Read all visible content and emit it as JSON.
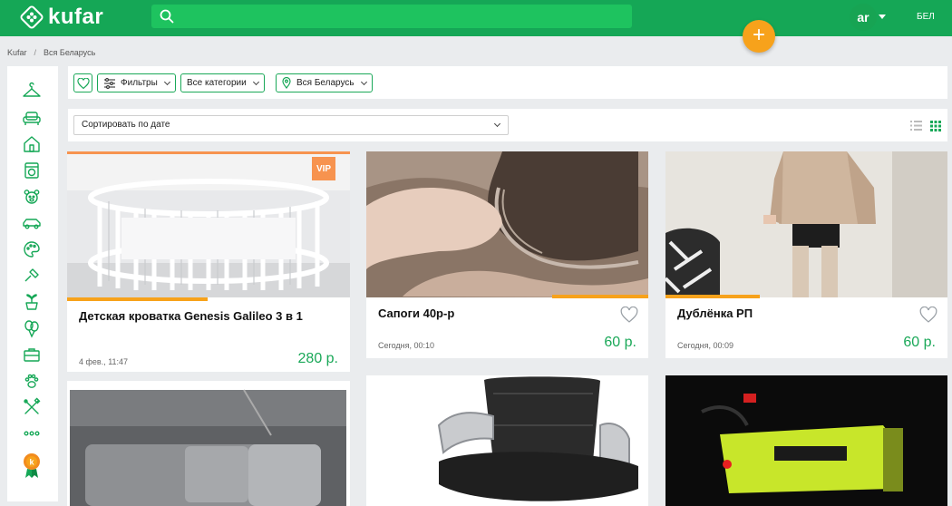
{
  "header": {
    "logo_text": "kufar",
    "search_placeholder": "",
    "user_initials": "ar",
    "language_label": "БЕЛ",
    "add_button_label": "+"
  },
  "breadcrumb": {
    "root": "Kufar",
    "separator": "/",
    "current": "Вся Беларусь"
  },
  "categories": [
    "hanger-icon",
    "sofa-icon",
    "house-icon",
    "washing-machine-icon",
    "teddy-bear-icon",
    "car-icon",
    "palette-icon",
    "hammer-icon",
    "plant-pot-icon",
    "balloons-icon",
    "briefcase-icon",
    "paw-icon",
    "tools-icon",
    "more-dots-icon",
    "kufar-badge-icon"
  ],
  "filters": {
    "filters_label": "Фильтры",
    "categories_label": "Все категории",
    "region_label": "Вся Беларусь"
  },
  "sort": {
    "value": "Сортировать по дате"
  },
  "listings": [
    {
      "title": "Детская кроватка Genesis Galileo 3 в 1",
      "date": "4 фев., 11:47",
      "price": "280 р.",
      "vip": "VIP"
    },
    {
      "title": "Сапоги 40р-р",
      "date": "Сегодня, 00:10",
      "price": "60 р."
    },
    {
      "title": "Дублёнка РП",
      "date": "Сегодня, 00:09",
      "price": "60 р."
    },
    {
      "title": ""
    },
    {
      "title": ""
    },
    {
      "title": ""
    }
  ],
  "colors": {
    "brand_green": "#15a756",
    "price_green": "#1aa858",
    "accent_orange": "#f7a21b",
    "vip_orange": "#f7934f"
  }
}
